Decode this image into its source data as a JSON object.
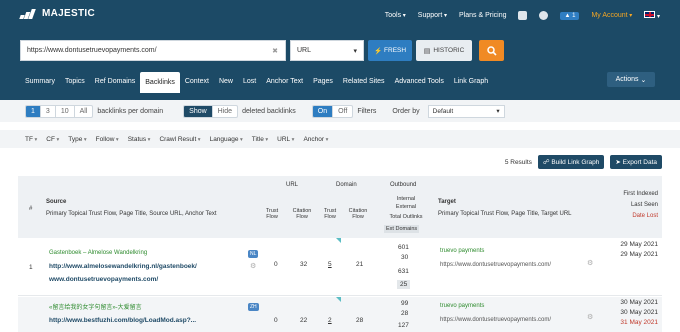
{
  "header": {
    "logo": "MAJESTIC",
    "nav": [
      "Tools",
      "Support",
      "Plans & Pricing"
    ],
    "badge_count": "1",
    "account": "My Account"
  },
  "search": {
    "url_value": "https://www.dontusetruevopayments.com/",
    "scope": "URL",
    "fresh_label": "FRESH",
    "historic_label": "HISTORIC"
  },
  "tabs": [
    "Summary",
    "Topics",
    "Ref Domains",
    "Backlinks",
    "Context",
    "New",
    "Lost",
    "Anchor Text",
    "Pages",
    "Related Sites",
    "Advanced Tools",
    "Link Graph"
  ],
  "actions_label": "Actions",
  "controls": {
    "per_domain": [
      "1",
      "3",
      "10",
      "All"
    ],
    "per_domain_label": "backlinks per domain",
    "show": "Show",
    "hide": "Hide",
    "deleted_label": "deleted backlinks",
    "on": "On",
    "off": "Off",
    "filters_label": "Filters",
    "order_by_label": "Order by",
    "order_by_value": "Default"
  },
  "filters": [
    "TF",
    "CF",
    "Type",
    "Follow",
    "Status",
    "Crawl Result",
    "Language",
    "Title",
    "URL",
    "Anchor"
  ],
  "results": {
    "count_text": "5 Results",
    "build_label": "Build Link Graph",
    "export_label": "Export Data"
  },
  "table_header": {
    "hash": "#",
    "source": "Source",
    "source_sub": "Primary Topical Trust Flow, Page Title, Source URL, Anchor Text",
    "url_group": "URL",
    "domain_group": "Domain",
    "outbound_group": "Outbound",
    "trust_flow": "Trust Flow",
    "citation_flow": "Citation Flow",
    "internal": "Internal",
    "external": "External",
    "total_outlinks": "Total Outlinks",
    "ext_domains": "Ext Domains",
    "target": "Target",
    "target_sub": "Primary Topical Trust Flow, Page Title, Target URL",
    "first_indexed": "First Indexed",
    "last_seen": "Last Seen",
    "date_lost": "Date Lost"
  },
  "rows": [
    {
      "num": "1",
      "title": "Gastenboek – Almelose Wandelkring",
      "url": "http://www.almelosewandelkring.nl/gastenboek/",
      "anchor": "www.dontusetruevopayments.com/",
      "lang": "NL",
      "url_tf": "0",
      "url_cf": "32",
      "dom_tf": "5",
      "dom_cf": "21",
      "internal": "601",
      "external": "30",
      "total": "631",
      "ext_domains": "25",
      "target_title": "truevo payments",
      "target_url": "https://www.dontusetruevopayments.com/",
      "first": "29 May 2021",
      "last": "29 May 2021"
    },
    {
      "num": "2",
      "title": "«留言给我的女字句留言»-大爱留言",
      "url": "http://www.bestfuzhi.com/blog/LoadMod.asp?...",
      "anchor": "",
      "lang": "ZH",
      "url_tf": "0",
      "url_cf": "22",
      "dom_tf": "2",
      "dom_cf": "28",
      "internal": "99",
      "external": "28",
      "total": "127",
      "ext_domains": "",
      "target_title": "truevo payments",
      "target_url": "https://www.dontusetruevopayments.com/",
      "first": "30 May 2021",
      "last": "30 May 2021",
      "lost": "31 May 2021"
    }
  ]
}
